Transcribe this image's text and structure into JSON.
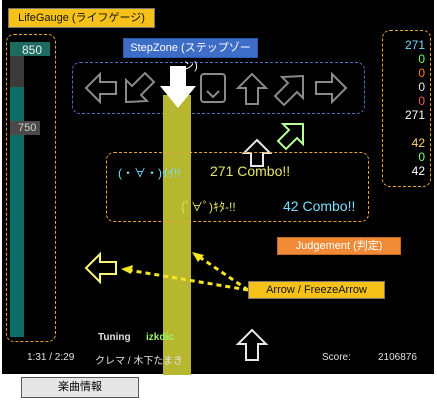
{
  "callouts": {
    "life_gauge": "LifeGauge (ライフゲージ)",
    "step_zone": "StepZone (ステップゾーン)",
    "judgement": "Judgement (判定)",
    "arrow": "Arrow / FreezeArrow",
    "music_info": "楽曲情報"
  },
  "life_gauge": {
    "max_label": "850",
    "current_label": "750",
    "level_fraction": 0.882
  },
  "judgement_counts": [
    "271",
    "0",
    "0",
    "0",
    "0",
    "271",
    "42",
    "0",
    "42"
  ],
  "judgement_colors": [
    "#7ad8ff",
    "#7cff6a",
    "#ff7f2a",
    "#e8e8e8",
    "#ff5b5b",
    "#ffffff",
    "#ffd66e",
    "#7cff6a",
    "#ffffff"
  ],
  "judgements": {
    "main_face": "(・∀・)ｲｲ!!",
    "main_combo": "271 Combo!!",
    "freeze_face": "(ﾟ∀ﾟ)ｷﾀ-!!",
    "freeze_combo": "42 Combo!!"
  },
  "credits": {
    "tuning_label": "Tuning",
    "tuning_name": "izkdic"
  },
  "music": {
    "time": "1:31  /  2:29",
    "title": "クレマ / 木下たまき",
    "score_label": "Score:",
    "score_value": "2106876"
  },
  "colors": {
    "freeze_arrow": "#b6b62f",
    "life_fill": "#0d6d67",
    "life_max_bar": "#1e6a60",
    "combo_yellow": "#e6e66a",
    "combo_cyan": "#79dfff",
    "green_arrow": "#b7ff9b",
    "callout_yellow": "#f6c21a",
    "callout_blue": "#3d6dc7",
    "callout_orange": "#f08a36"
  }
}
